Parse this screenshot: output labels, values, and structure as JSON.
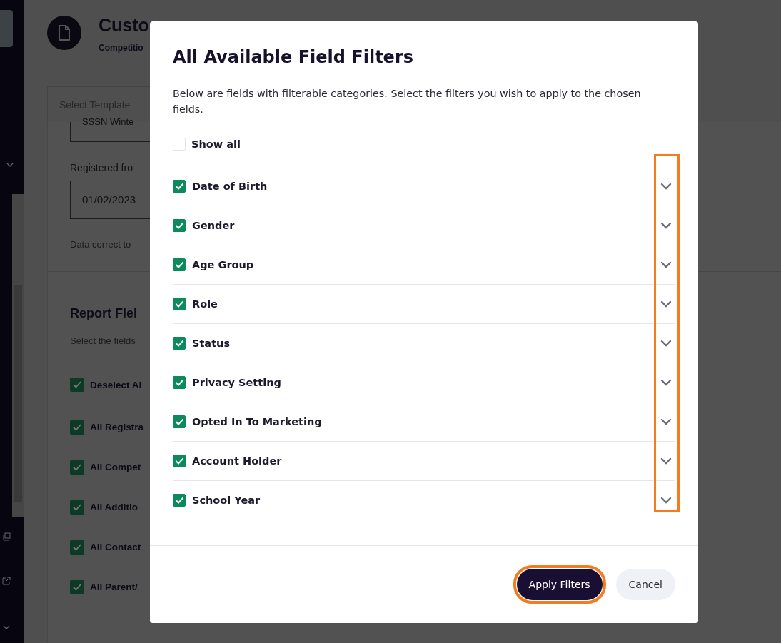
{
  "page": {
    "title": "Custo",
    "subtitle": "Competitio",
    "template_select": {
      "placeholder": "Select Template"
    },
    "season_field": {
      "value": "SSSN Winte"
    },
    "registered_label": "Registered fro",
    "date_field": {
      "value": "01/02/2023"
    },
    "data_note": "Data correct to",
    "report_heading": "Report Fiel",
    "report_desc": "Select the fields",
    "field_options": [
      {
        "label": "Deselect Al",
        "checked": true
      },
      {
        "label": "All Registra",
        "checked": true
      },
      {
        "label": "All Compet",
        "checked": true
      },
      {
        "label": "All Additio",
        "checked": true
      },
      {
        "label": "All Contact",
        "checked": true
      },
      {
        "label": "All Parent/",
        "checked": true
      }
    ]
  },
  "dialog": {
    "title": "All Available Field Filters",
    "description": "Below are fields with filterable categories. Select the filters you wish to apply to the chosen fields.",
    "show_all": {
      "label": "Show all",
      "checked": false
    },
    "filters": [
      {
        "label": "Date of Birth",
        "checked": true,
        "expanded": false
      },
      {
        "label": "Gender",
        "checked": true,
        "expanded": false
      },
      {
        "label": "Age Group",
        "checked": true,
        "expanded": false
      },
      {
        "label": "Role",
        "checked": true,
        "expanded": false
      },
      {
        "label": "Status",
        "checked": true,
        "expanded": false
      },
      {
        "label": "Privacy Setting",
        "checked": true,
        "expanded": false
      },
      {
        "label": "Opted In To Marketing",
        "checked": true,
        "expanded": false
      },
      {
        "label": "Account Holder",
        "checked": true,
        "expanded": false
      },
      {
        "label": "School Year",
        "checked": true,
        "expanded": false
      }
    ],
    "buttons": [
      {
        "label": "Apply Filters",
        "kind": "primary"
      },
      {
        "label": "Cancel",
        "kind": "secondary"
      }
    ]
  }
}
